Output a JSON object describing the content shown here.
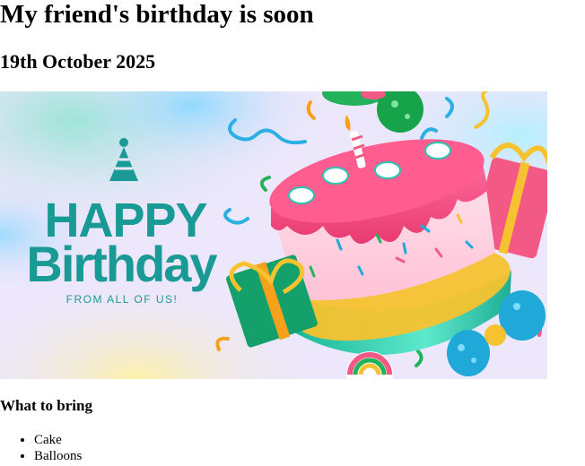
{
  "heading": "My friend's birthday is soon",
  "date": "19th October 2025",
  "banner": {
    "line1": "HAPPY",
    "line2": "Birthday",
    "sub": "FROM ALL OF US!",
    "colors": {
      "background": "#e9e4fb",
      "text_teal": "#1a9a95",
      "cake_pink": "#f2467e",
      "cake_frosting": "#ffd3e2",
      "cake_base": "#26c7a6",
      "gift_red": "#f25a85",
      "gift_green": "#14a06a",
      "ribbon_gold": "#f7c22f",
      "balloon_blue": "#1fa8d8",
      "balloon_green": "#22b35a"
    }
  },
  "section_title": "What to bring",
  "items": [
    "Cake",
    "Balloons"
  ]
}
